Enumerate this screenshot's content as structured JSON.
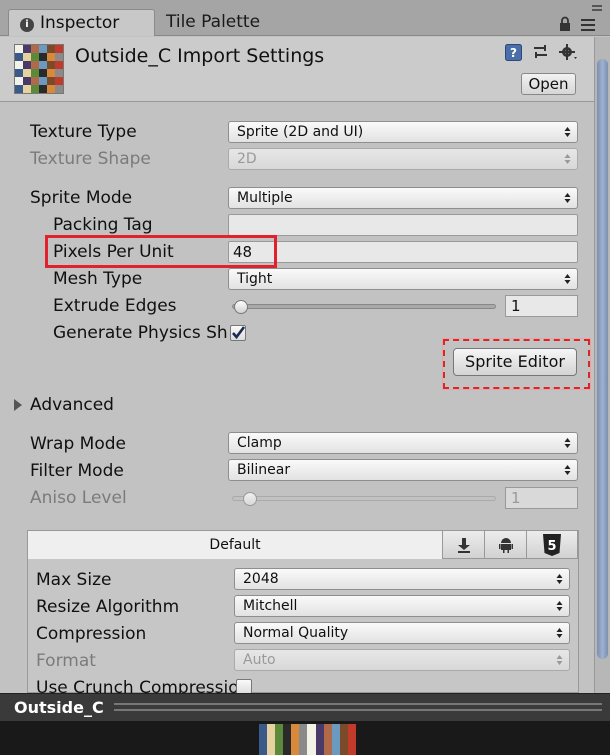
{
  "tabs": [
    {
      "label": "Inspector",
      "active": true
    },
    {
      "label": "Tile Palette",
      "active": false
    }
  ],
  "header": {
    "title": "Outside_C Import Settings",
    "open_label": "Open"
  },
  "fields": {
    "texture_type": {
      "label": "Texture Type",
      "value": "Sprite (2D and UI)"
    },
    "texture_shape": {
      "label": "Texture Shape",
      "value": "2D"
    },
    "sprite_mode": {
      "label": "Sprite Mode",
      "value": "Multiple"
    },
    "packing_tag": {
      "label": "Packing Tag",
      "value": ""
    },
    "pixels_per_unit": {
      "label": "Pixels Per Unit",
      "value": "48"
    },
    "mesh_type": {
      "label": "Mesh Type",
      "value": "Tight"
    },
    "extrude_edges": {
      "label": "Extrude Edges",
      "value": "1",
      "slider_fraction": 0.0
    },
    "generate_physics": {
      "label": "Generate Physics Sh",
      "checked": true
    },
    "sprite_editor_label": "Sprite Editor",
    "advanced_label": "Advanced",
    "wrap_mode": {
      "label": "Wrap Mode",
      "value": "Clamp"
    },
    "filter_mode": {
      "label": "Filter Mode",
      "value": "Bilinear"
    },
    "aniso_level": {
      "label": "Aniso Level",
      "value": "1",
      "slider_fraction": 0.06
    }
  },
  "platform": {
    "default_tab": "Default",
    "tab_icons": [
      "download-icon",
      "android-icon",
      "html5-icon"
    ],
    "max_size": {
      "label": "Max Size",
      "value": "2048"
    },
    "resize_algorithm": {
      "label": "Resize Algorithm",
      "value": "Mitchell"
    },
    "compression": {
      "label": "Compression",
      "value": "Normal Quality"
    },
    "format": {
      "label": "Format",
      "value": "Auto"
    },
    "use_crunch": {
      "label": "Use Crunch Compressio",
      "checked": false
    }
  },
  "preview": {
    "title": "Outside_C"
  },
  "colors": {
    "highlight": "#e0222e",
    "scroll_thumb": "#8ea0c0",
    "preview_bg": "#191919"
  }
}
